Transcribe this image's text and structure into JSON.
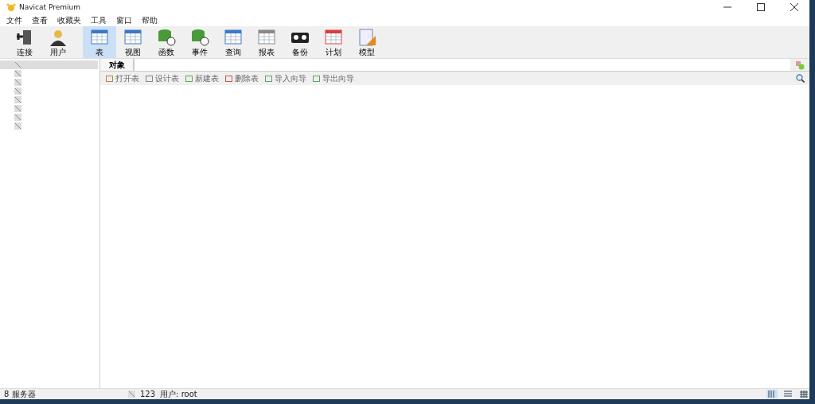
{
  "window": {
    "title": "Navicat Premium"
  },
  "menu": [
    "文件",
    "查看",
    "收藏夹",
    "工具",
    "窗口",
    "帮助"
  ],
  "toolbar": [
    {
      "label": "连接",
      "kind": "connect",
      "selected": false
    },
    {
      "label": "用户",
      "kind": "user",
      "selected": false
    },
    {
      "label": "表",
      "kind": "table",
      "selected": true
    },
    {
      "label": "视图",
      "kind": "view",
      "selected": false
    },
    {
      "label": "函数",
      "kind": "function",
      "selected": false
    },
    {
      "label": "事件",
      "kind": "event",
      "selected": false
    },
    {
      "label": "查询",
      "kind": "query",
      "selected": false
    },
    {
      "label": "报表",
      "kind": "report",
      "selected": false
    },
    {
      "label": "备份",
      "kind": "backup",
      "selected": false
    },
    {
      "label": "计划",
      "kind": "schedule",
      "selected": false
    },
    {
      "label": "模型",
      "kind": "model",
      "selected": false
    }
  ],
  "sidebar": {
    "items": [
      {
        "selected": true
      },
      {
        "selected": false
      },
      {
        "selected": false
      },
      {
        "selected": false
      },
      {
        "selected": false
      },
      {
        "selected": false
      },
      {
        "selected": false
      },
      {
        "selected": false
      }
    ]
  },
  "tabs": [
    {
      "label": "对象",
      "selected": true
    }
  ],
  "object_toolbar": [
    "打开表",
    "设计表",
    "新建表",
    "删除表",
    "导入向导",
    "导出向导"
  ],
  "status_bar": {
    "servers": "8 服务器",
    "connection": "123",
    "user": "用户: root"
  },
  "view_modes": [
    {
      "kind": "list",
      "selected": true
    },
    {
      "kind": "detail",
      "selected": false
    },
    {
      "kind": "grid",
      "selected": false
    }
  ]
}
